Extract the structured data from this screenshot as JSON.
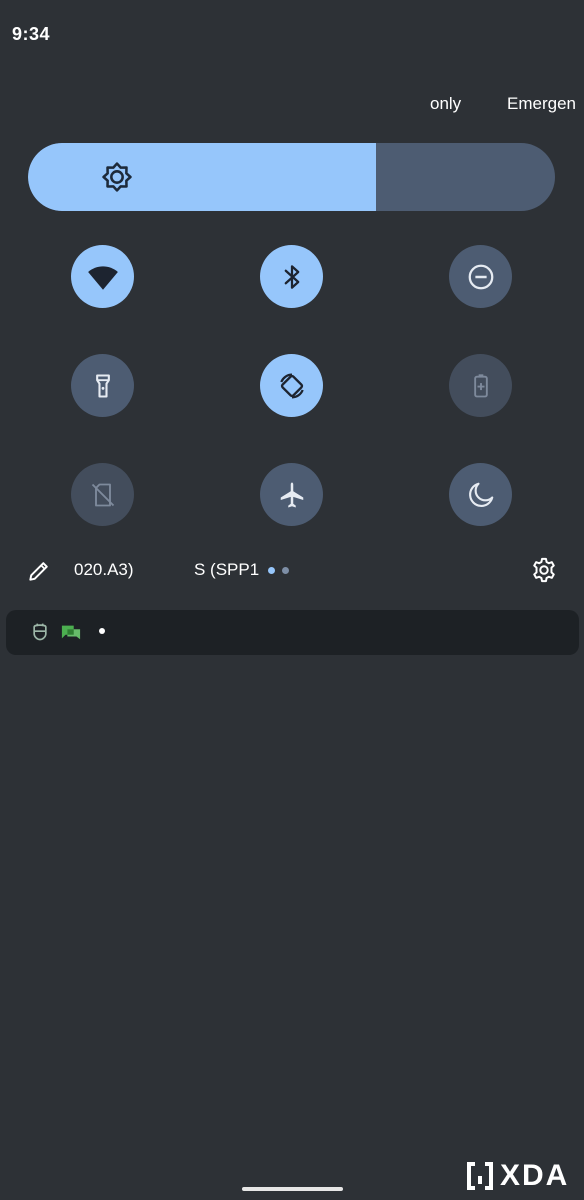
{
  "status_bar": {
    "time": "9:34"
  },
  "header": {
    "carrier_left": "only",
    "carrier_right": "Emergen"
  },
  "brightness": {
    "level": 0.66,
    "icon": "brightness-icon"
  },
  "tiles": [
    {
      "name": "wifi",
      "icon": "wifi-icon",
      "state": "on"
    },
    {
      "name": "bluetooth",
      "icon": "bluetooth-icon",
      "state": "on"
    },
    {
      "name": "do-not-disturb",
      "icon": "do-not-disturb-icon",
      "state": "off"
    },
    {
      "name": "flashlight",
      "icon": "flashlight-icon",
      "state": "off"
    },
    {
      "name": "auto-rotate",
      "icon": "rotate-icon",
      "state": "on"
    },
    {
      "name": "battery-saver",
      "icon": "battery-saver-icon",
      "state": "unavailable"
    },
    {
      "name": "mobile-data",
      "icon": "no-sim-icon",
      "state": "unavailable"
    },
    {
      "name": "airplane-mode",
      "icon": "airplane-icon",
      "state": "off"
    },
    {
      "name": "night-light",
      "icon": "moon-icon",
      "state": "off"
    }
  ],
  "footer": {
    "network_1": "020.A3)",
    "network_2": "S (SPP1",
    "page_indicator": {
      "pages": 2,
      "current": 1
    },
    "edit_icon": "pencil-icon",
    "settings_icon": "gear-icon"
  },
  "notifications": {
    "icons": [
      "alien-icon",
      "chat-bubbles-icon"
    ],
    "overflow": "dot"
  },
  "colors": {
    "background": "#2d3136",
    "tile_on": "#96c6fb",
    "tile_off": "#4d5c72",
    "tile_unavailable": "#434d5c",
    "icon_on": "#1d2430",
    "icon_off": "#e6ebf2",
    "notification_bar": "#1d2125"
  },
  "watermark": {
    "text": "XDA"
  }
}
